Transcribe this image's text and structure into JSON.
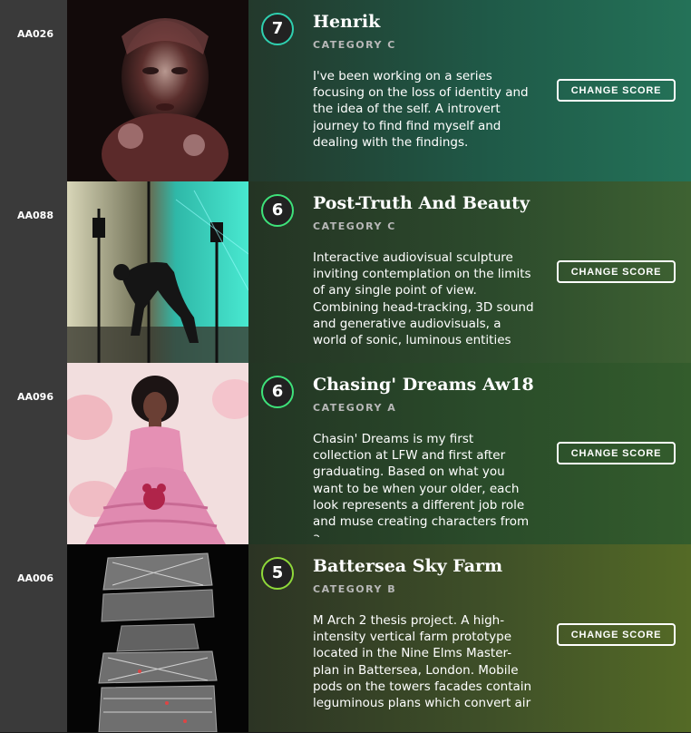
{
  "change_score_label": "CHANGE SCORE",
  "entries": [
    {
      "id": "AA026",
      "score": "7",
      "title": "Henrik",
      "category": "CATEGORY C",
      "description": "I've been working on a series focusing on the loss of identity and the idea of the self. A introvert journey to find find myself and dealing with the findings."
    },
    {
      "id": "AA088",
      "score": "6",
      "title": "Post-Truth And Beauty",
      "category": "CATEGORY C",
      "description": "Interactive audiovisual sculpture inviting contemplation on the limits of any single point of view. Combining head-tracking, 3D sound and generative audiovisuals, a world of sonic, luminous entities"
    },
    {
      "id": "AA096",
      "score": "6",
      "title": "Chasing' Dreams Aw18",
      "category": "CATEGORY A",
      "description": "Chasin' Dreams is my first collection at LFW and first after graduating. Based on what you want to be when your older, each look represents a different job role and muse creating characters from a"
    },
    {
      "id": "AA006",
      "score": "5",
      "title": "Battersea Sky Farm",
      "category": "CATEGORY B",
      "description": "M Arch 2 thesis project. A high-intensity vertical farm prototype located in the Nine Elms Master-plan in Battersea, London. Mobile pods on the towers facades contain leguminous plans which convert air"
    }
  ],
  "colors": {
    "badge_ring_teal": "#2fd0b0",
    "badge_ring_green": "#3ee27a",
    "badge_ring_lime": "#8fd83a",
    "id_column_bg": "#3a3a3a"
  }
}
